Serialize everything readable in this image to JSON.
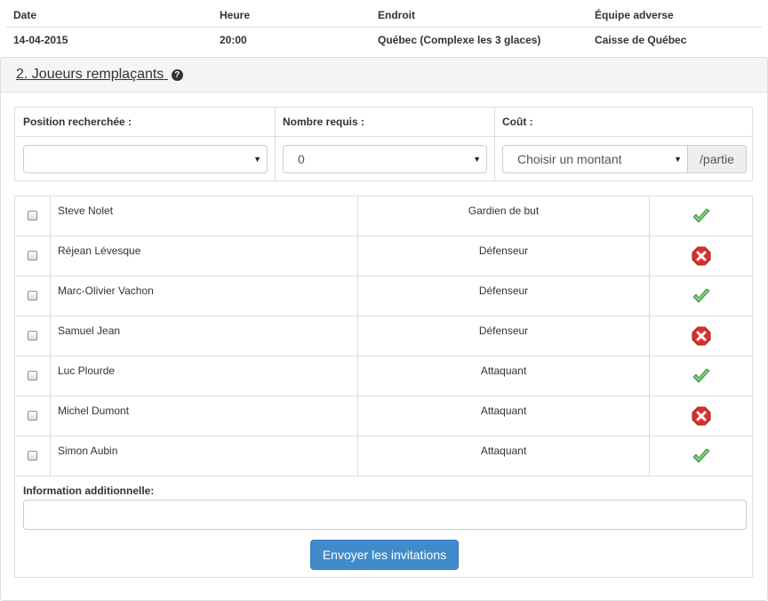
{
  "game": {
    "headers": {
      "date": "Date",
      "time": "Heure",
      "location": "Endroit",
      "opponent": "Équipe adverse"
    },
    "values": {
      "date": "14-04-2015",
      "time": "20:00",
      "location": "Québec (Complexe les 3 glaces)",
      "opponent": "Caisse de Québec"
    }
  },
  "panel": {
    "title": "2. Joueurs remplaçants",
    "help_glyph": "?"
  },
  "filters": {
    "position_label": "Position recherchée :",
    "position_value": "",
    "count_label": "Nombre requis :",
    "count_value": "0",
    "cost_label": "Coût :",
    "cost_value": "Choisir un montant",
    "cost_addon": "/partie"
  },
  "players": [
    {
      "name": "Steve Nolet",
      "position": "Gardien de but",
      "status": "available",
      "icon": "check-icon"
    },
    {
      "name": "Réjean Lévesque",
      "position": "Défenseur",
      "status": "unavailable",
      "icon": "cross-icon"
    },
    {
      "name": "Marc-Olivier Vachon",
      "position": "Défenseur",
      "status": "available",
      "icon": "check-icon"
    },
    {
      "name": "Samuel Jean",
      "position": "Défenseur",
      "status": "unavailable",
      "icon": "cross-icon"
    },
    {
      "name": "Luc Plourde",
      "position": "Attaquant",
      "status": "available",
      "icon": "check-icon"
    },
    {
      "name": "Michel Dumont",
      "position": "Attaquant",
      "status": "unavailable",
      "icon": "cross-icon"
    },
    {
      "name": "Simon Aubin",
      "position": "Attaquant",
      "status": "available",
      "icon": "check-icon"
    }
  ],
  "extra": {
    "label": "Information additionnelle:",
    "value": ""
  },
  "send_button": "Envoyer les invitations",
  "colors": {
    "primary": "#428bca",
    "check": "#5cb85c",
    "cross": "#d9302c"
  }
}
